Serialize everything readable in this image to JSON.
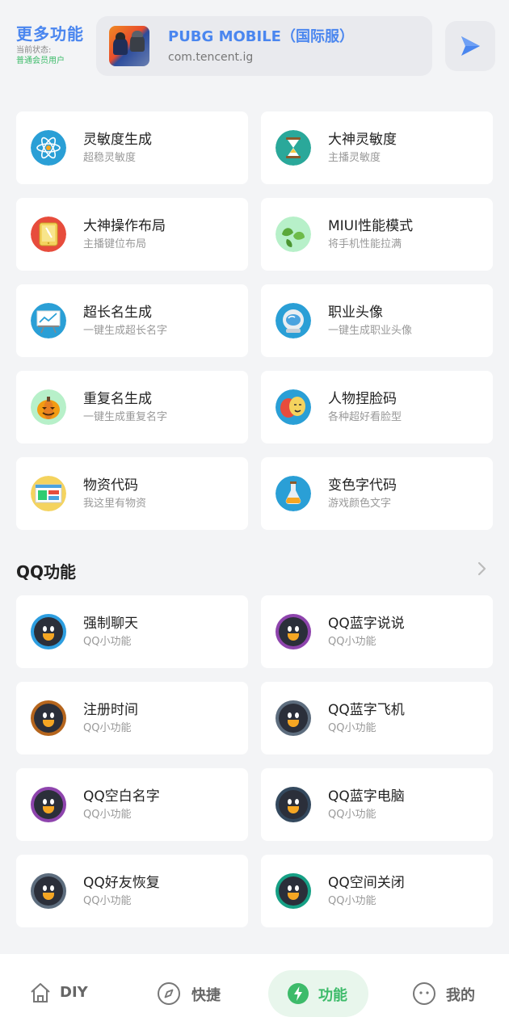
{
  "header": {
    "title": "更多功能",
    "status_label": "当前状态:",
    "status_value": "普通会员用户",
    "game": {
      "name": "PUBG MOBILE（国际服）",
      "package": "com.tencent.ig"
    }
  },
  "features": [
    {
      "title": "灵敏度生成",
      "sub": "超稳灵敏度",
      "icon": "atom-icon"
    },
    {
      "title": "大神灵敏度",
      "sub": "主播灵敏度",
      "icon": "hourglass-icon"
    },
    {
      "title": "大神操作布局",
      "sub": "主播键位布局",
      "icon": "tablet-icon"
    },
    {
      "title": "MIUI性能模式",
      "sub": "将手机性能拉满",
      "icon": "leaves-icon"
    },
    {
      "title": "超长名生成",
      "sub": "一键生成超长名字",
      "icon": "presentation-icon"
    },
    {
      "title": "职业头像",
      "sub": "一键生成职业头像",
      "icon": "astronaut-helmet-icon"
    },
    {
      "title": "重复名生成",
      "sub": "一键生成重复名字",
      "icon": "pumpkin-icon"
    },
    {
      "title": "人物捏脸码",
      "sub": "各种超好看脸型",
      "icon": "theater-masks-icon"
    },
    {
      "title": "物资代码",
      "sub": "我这里有物资",
      "icon": "dashboard-icon"
    },
    {
      "title": "变色字代码",
      "sub": "游戏颜色文字",
      "icon": "flask-icon"
    }
  ],
  "qq_section": {
    "title": "QQ功能",
    "items": [
      {
        "title": "强制聊天",
        "sub": "QQ小功能",
        "ring": "#2d9ee0"
      },
      {
        "title": "QQ蓝字说说",
        "sub": "QQ小功能",
        "ring": "#8e44ad"
      },
      {
        "title": "注册时间",
        "sub": "QQ小功能",
        "ring": "#b5651d"
      },
      {
        "title": "QQ蓝字飞机",
        "sub": "QQ小功能",
        "ring": "#5d6d7e"
      },
      {
        "title": "QQ空白名字",
        "sub": "QQ小功能",
        "ring": "#8e44ad"
      },
      {
        "title": "QQ蓝字电脑",
        "sub": "QQ小功能",
        "ring": "#34495e"
      },
      {
        "title": "QQ好友恢复",
        "sub": "QQ小功能",
        "ring": "#5d6d7e"
      },
      {
        "title": "QQ空间关闭",
        "sub": "QQ小功能",
        "ring": "#16a085"
      }
    ]
  },
  "nav": {
    "items": [
      {
        "label": "DIY",
        "icon": "home-icon"
      },
      {
        "label": "快捷",
        "icon": "compass-icon"
      },
      {
        "label": "功能",
        "icon": "bolt-icon",
        "active": true
      },
      {
        "label": "我的",
        "icon": "face-icon"
      }
    ]
  },
  "colors": {
    "accent": "#4a86ef",
    "active_green": "#3dbb6a",
    "background": "#f3f4f6"
  }
}
